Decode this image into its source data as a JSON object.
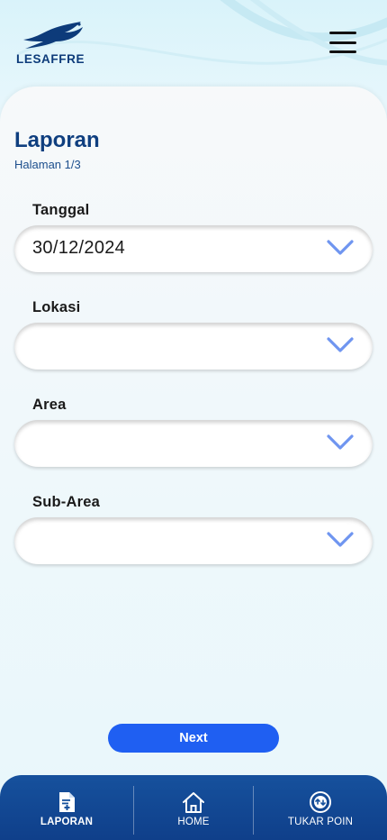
{
  "brand": {
    "name": "LESAFFRE"
  },
  "header": {
    "menu_icon": "hamburger-menu-icon"
  },
  "page": {
    "title": "Laporan",
    "subtitle": "Halaman 1/3"
  },
  "form": {
    "fields": [
      {
        "label": "Tanggal",
        "value": "30/12/2024"
      },
      {
        "label": "Lokasi",
        "value": ""
      },
      {
        "label": "Area",
        "value": ""
      },
      {
        "label": "Sub-Area",
        "value": ""
      }
    ],
    "next_label": "Next"
  },
  "bottom_nav": {
    "items": [
      {
        "label": "LAPORAN",
        "icon": "report-add-icon",
        "active": true
      },
      {
        "label": "HOME",
        "icon": "home-icon",
        "active": false
      },
      {
        "label": "TUKAR POIN",
        "icon": "exchange-points-icon",
        "active": false
      }
    ]
  },
  "colors": {
    "brand_blue": "#0f3f7f",
    "button_blue": "#1f5ff2",
    "nav_blue": "#16519d",
    "chevron_blue": "#6f95f0"
  }
}
